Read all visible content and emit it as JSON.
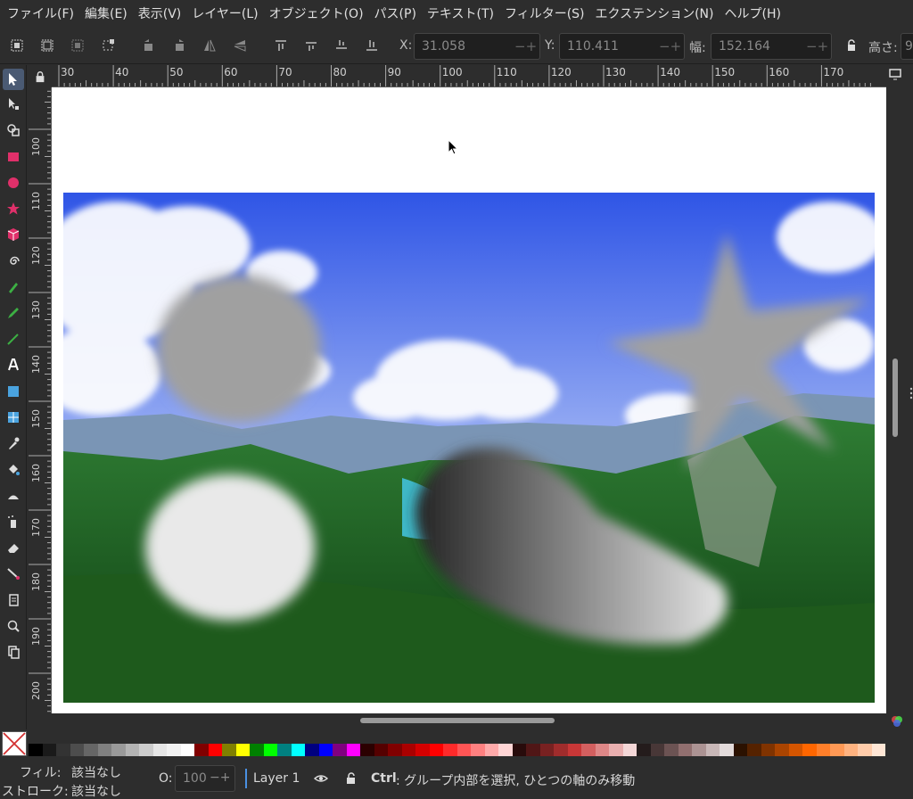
{
  "menubar": {
    "items": [
      {
        "label": "ファイル(F)"
      },
      {
        "label": "編集(E)"
      },
      {
        "label": "表示(V)"
      },
      {
        "label": "レイヤー(L)"
      },
      {
        "label": "オブジェクト(O)"
      },
      {
        "label": "パス(P)"
      },
      {
        "label": "テキスト(T)"
      },
      {
        "label": "フィルター(S)"
      },
      {
        "label": "エクステンション(N)"
      },
      {
        "label": "ヘルプ(H)"
      }
    ]
  },
  "toolcontrols": {
    "x_label": "X:",
    "x_value": "31.058",
    "y_label": "Y:",
    "y_value": "110.411",
    "w_label": "幅:",
    "w_value": "152.164",
    "h_label": "高さ:",
    "h_value": "9"
  },
  "ruler_top": {
    "labels": [
      "30",
      "40",
      "50",
      "60",
      "70",
      "80",
      "90",
      "100",
      "110",
      "120",
      "130",
      "140",
      "150",
      "160",
      "170"
    ]
  },
  "ruler_left": {
    "labels": [
      "100",
      "110",
      "120",
      "130",
      "140",
      "150",
      "160",
      "170",
      "180",
      "190",
      "200"
    ]
  },
  "statusbar": {
    "fill_label": "フィル:",
    "fill_value": "該当なし",
    "stroke_label": "ストローク:",
    "stroke_value": "該当なし",
    "opacity_label": "O:",
    "opacity_value": "100",
    "layer_name": "Layer 1",
    "hint_key": "Ctrl",
    "hint_text": ": グループ内部を選択, ひとつの軸のみ移動"
  },
  "palette": {
    "colors": [
      "#000000",
      "#1a1a1a",
      "#333333",
      "#4d4d4d",
      "#666666",
      "#808080",
      "#999999",
      "#b3b3b3",
      "#cccccc",
      "#e6e6e6",
      "#f2f2f2",
      "#ffffff",
      "#800000",
      "#ff0000",
      "#808000",
      "#ffff00",
      "#008000",
      "#00ff00",
      "#008080",
      "#00ffff",
      "#000080",
      "#0000ff",
      "#800080",
      "#ff00ff",
      "#2b0000",
      "#550000",
      "#800000",
      "#aa0000",
      "#d40000",
      "#ff0000",
      "#ff2a2a",
      "#ff5555",
      "#ff8080",
      "#ffaaaa",
      "#ffd5d5",
      "#280b0b",
      "#501616",
      "#782121",
      "#a02c2c",
      "#c83737",
      "#d35f5f",
      "#de8787",
      "#e9afaf",
      "#f4d7d7",
      "#241c1c",
      "#483737",
      "#6c5353",
      "#916f6f",
      "#ac9393",
      "#c8b7b7",
      "#e3dbdb",
      "#2b1100",
      "#552200",
      "#803300",
      "#aa4400",
      "#d45500",
      "#ff6600",
      "#ff7f2a",
      "#ff9955",
      "#ffb380",
      "#ffccaa",
      "#ffe6d5"
    ]
  },
  "colors": {
    "accent": "#4a90e2",
    "active_tool": "#4a5a73"
  }
}
